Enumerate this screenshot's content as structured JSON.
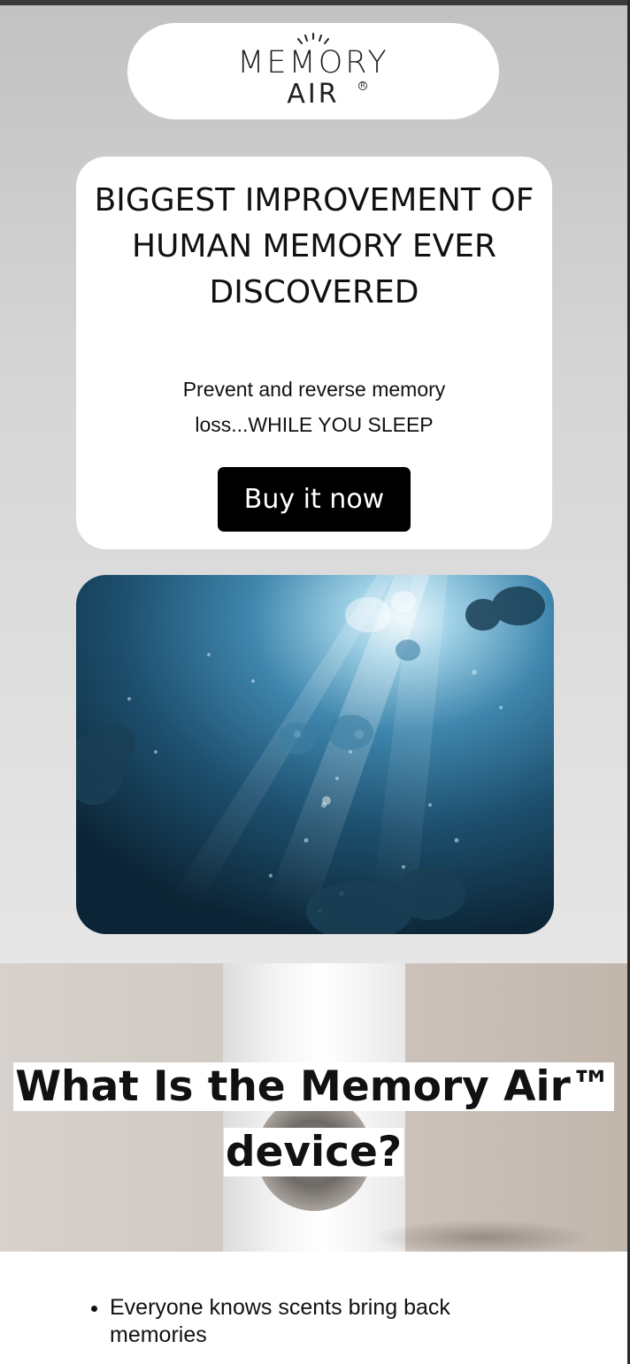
{
  "logo": {
    "line1": "MEMORY",
    "line2": "AIR",
    "registered": "R"
  },
  "hero": {
    "headline": "BIGGEST IMPROVEMENT OF HUMAN MEMORY EVER DISCOVERED",
    "subtext": "Prevent and reverse memory loss...WHILE YOU SLEEP",
    "buy_button": "Buy it now"
  },
  "device_section": {
    "title": "What Is the Memory Air™ device?"
  },
  "bullets": [
    "Everyone knows scents bring back memories"
  ],
  "colors": {
    "button_bg": "#000000",
    "card_bg": "#ffffff",
    "hero_bg_top": "#c2c2c2",
    "hero_bg_bottom": "#e6e6e6"
  }
}
